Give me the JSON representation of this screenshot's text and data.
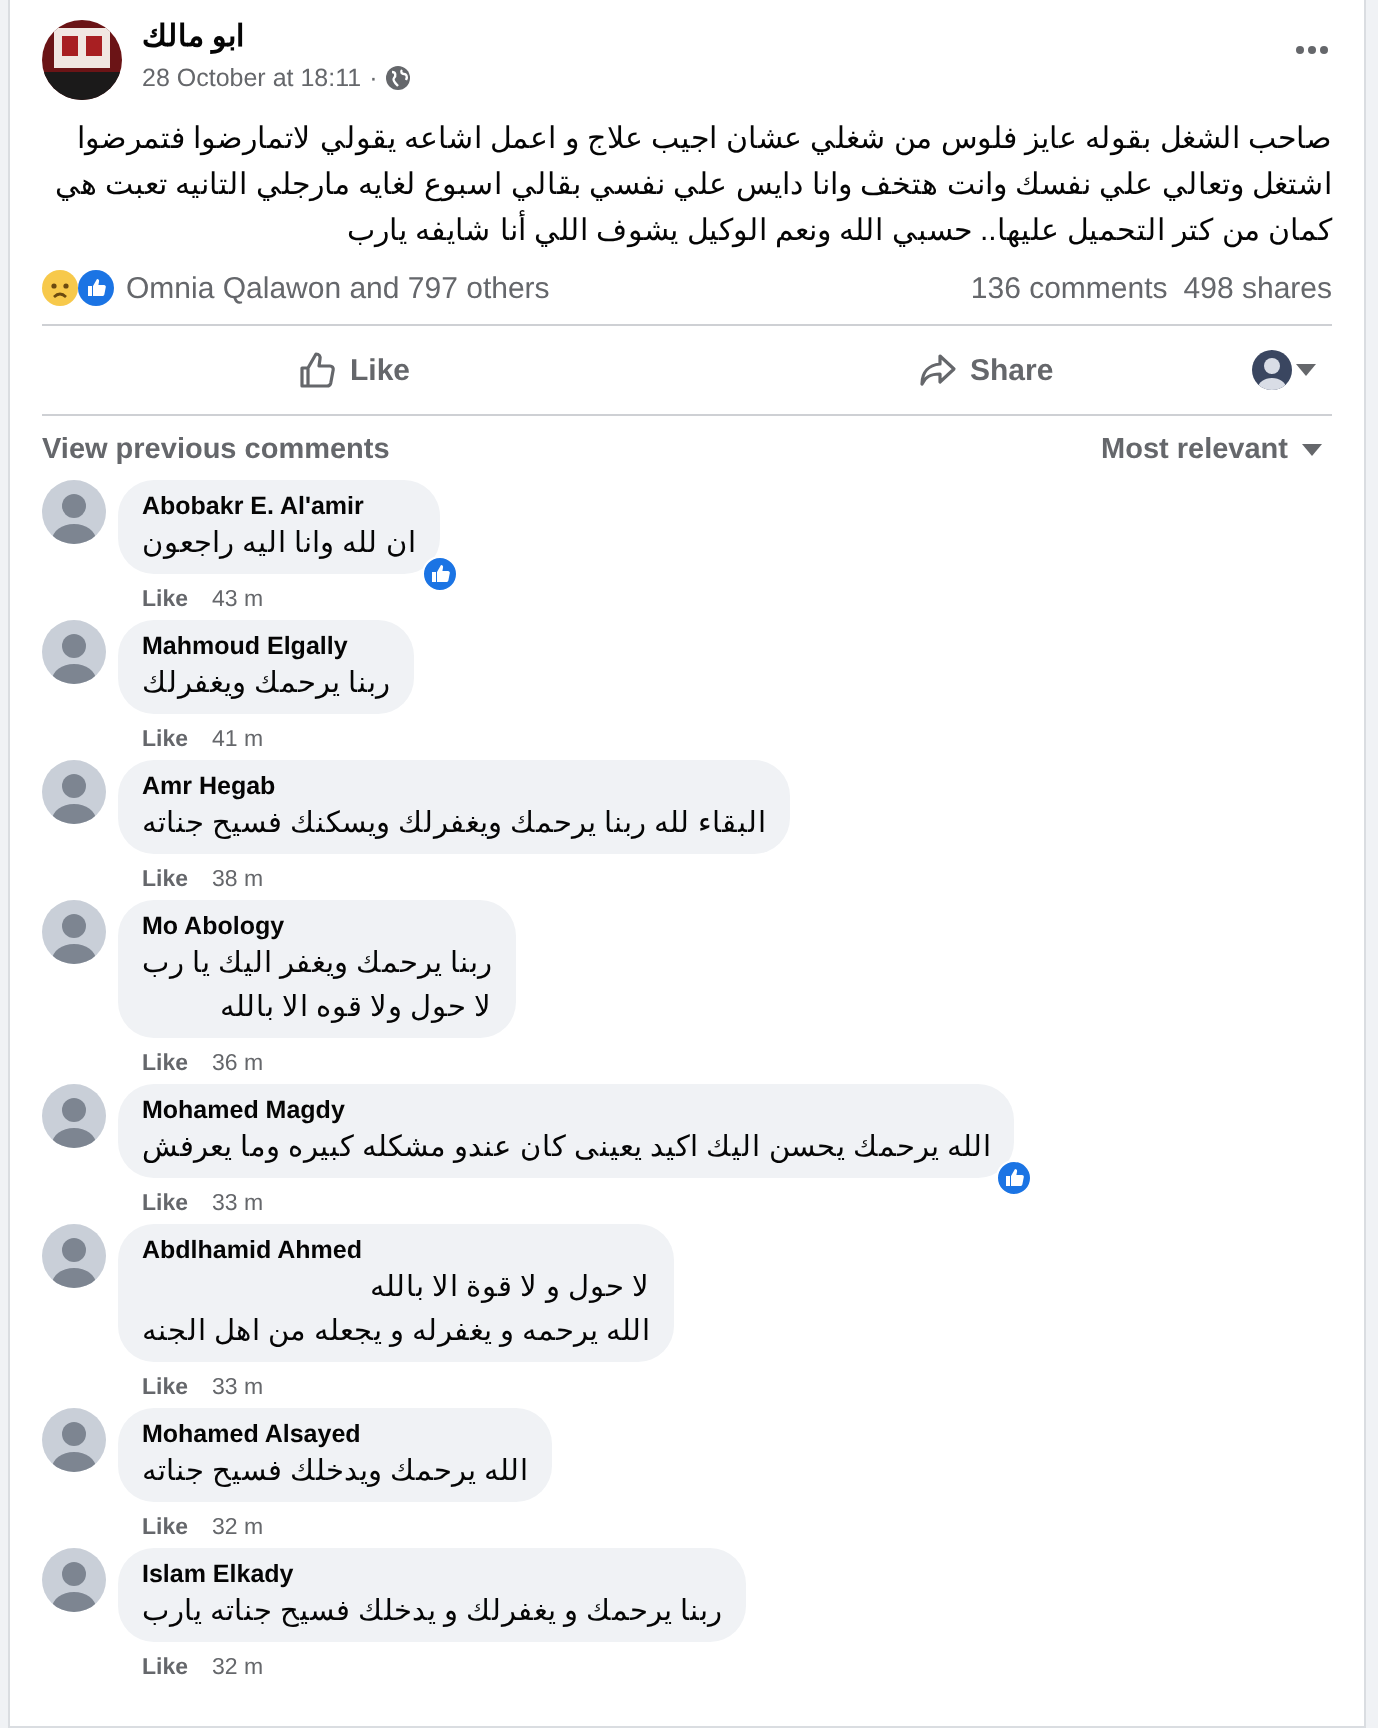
{
  "post": {
    "author": "ابو مالك",
    "time": "28 October at 18:11",
    "separator": "·",
    "text": "صاحب الشغل بقوله عايز فلوس من شغلي عشان اجيب علاج و اعمل اشاعه يقولي لاتمارضوا فتمرضوا اشتغل وتعالي علي نفسك وانت هتخف وانا دايس علي نفسي بقالي اسبوع لغايه مارجلي التانيه تعبت هي كمان من كتر التحميل عليها.. حسبي الله ونعم الوكيل يشوف اللي أنا شايفه يارب",
    "reactions_text": "Omnia Qalawon and 797 others",
    "comments_count": "136 comments",
    "shares_count": "498 shares",
    "like_action": {
      "label": "Like"
    },
    "share_action": {
      "label": "Share"
    }
  },
  "comments_bar": {
    "view_previous": "View previous comments",
    "sort": "Most relevant"
  },
  "comments": [
    {
      "author": "Abobakr E. Al'amir",
      "text": "ان لله وانا اليه راجعون",
      "like_label": "Like",
      "time": "43 m",
      "liked": true
    },
    {
      "author": "Mahmoud Elgally",
      "text": "ربنا يرحمك ويغفرلك",
      "like_label": "Like",
      "time": "41 m",
      "liked": false
    },
    {
      "author": "Amr Hegab",
      "text": "البقاء لله ربنا يرحمك ويغفرلك ويسكنك فسيح جناته",
      "like_label": "Like",
      "time": "38 m",
      "liked": false
    },
    {
      "author": "Mo Abology",
      "text": "ربنا يرحمك ويغفر اليك يا رب\nلا حول ولا قوه الا بالله",
      "like_label": "Like",
      "time": "36 m",
      "liked": false
    },
    {
      "author": "Mohamed Magdy",
      "text": "الله يرحمك يحسن اليك اكيد يعينى كان عندو مشكله كبيره وما يعرفش",
      "like_label": "Like",
      "time": "33 m",
      "liked": true
    },
    {
      "author": "Abdlhamid Ahmed",
      "text": "لا حول و لا قوة الا بالله\nالله يرحمه و يغفرله و يجعله من اهل الجنه",
      "like_label": "Like",
      "time": "33 m",
      "liked": false
    },
    {
      "author": "Mohamed Alsayed",
      "text": "الله يرحمك ويدخلك فسيح جناته",
      "like_label": "Like",
      "time": "32 m",
      "liked": false
    },
    {
      "author": "Islam Elkady",
      "text": "ربنا يرحمك و يغفرلك و يدخلك فسيح جناته يارب",
      "like_label": "Like",
      "time": "32 m",
      "liked": false
    }
  ]
}
